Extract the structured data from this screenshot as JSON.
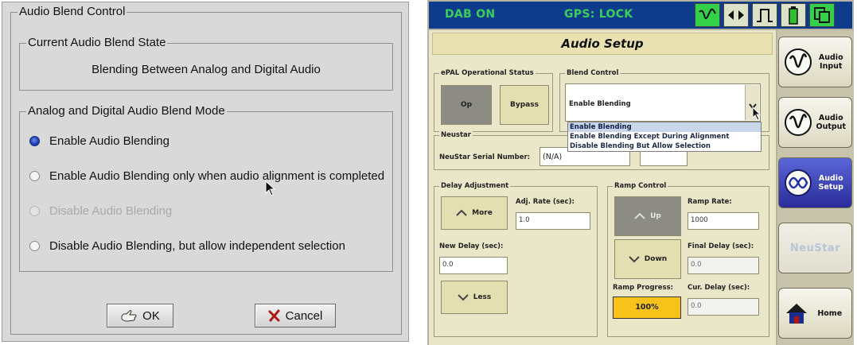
{
  "left_dialog": {
    "title": "Audio Blend Control",
    "state_group_title": "Current Audio Blend State",
    "state_text": "Blending Between Analog and Digital Audio",
    "mode_group_title": "Analog and Digital Audio Blend Mode",
    "options": [
      {
        "label": "Enable Audio Blending",
        "checked": true,
        "disabled": false
      },
      {
        "label": "Enable Audio Blending only when audio alignment is completed",
        "checked": false,
        "disabled": false
      },
      {
        "label": "Disable Audio Blending",
        "checked": false,
        "disabled": true
      },
      {
        "label": "Disable Audio Blending, but allow independent selection",
        "checked": false,
        "disabled": false
      }
    ],
    "ok_label": "OK",
    "cancel_label": "Cancel"
  },
  "right_panel": {
    "status": {
      "dab": "DAB ON",
      "gps": "GPS: LOCK",
      "icons": [
        "waveform-icon",
        "arrows-icon",
        "pulse-icon",
        "battery-icon",
        "copy-icon"
      ],
      "colors": {
        "bar": "#0f3b8c",
        "text": "#37d05a",
        "active_icon_bg": "#35d04a"
      }
    },
    "title": "Audio Setup",
    "epal": {
      "title": "ePAL Operational Status",
      "op_label": "Op",
      "bypass_label": "Bypass"
    },
    "blend": {
      "title": "Blend Control",
      "selected": "Enable Blending",
      "options": [
        "Enable Blending",
        "Enable Blending Except During Alignment",
        "Disable Blending But Allow Selection"
      ]
    },
    "neustar": {
      "title": "Neustar",
      "serial_label": "NeuStar Serial Number:",
      "serial_value": "(N/A)"
    },
    "delay": {
      "title": "Delay Adjustment",
      "more_label": "More",
      "less_label": "Less",
      "adj_rate_label": "Adj. Rate (sec):",
      "adj_rate_value": "1.0",
      "new_delay_label": "New Delay (sec):",
      "new_delay_value": "0.0"
    },
    "ramp": {
      "title": "Ramp Control",
      "up_label": "Up",
      "down_label": "Down",
      "ramp_rate_label": "Ramp Rate:",
      "ramp_rate_value": "1000",
      "final_delay_label": "Final Delay (sec):",
      "final_delay_value": "0.0",
      "progress_label": "Ramp Progress:",
      "progress_value": "100%",
      "progress_fraction": 1.0,
      "cur_delay_label": "Cur. Delay (sec):",
      "cur_delay_value": "0.0"
    },
    "nav": [
      {
        "label": "Audio Input",
        "icon": "wave-icon",
        "state": "normal"
      },
      {
        "label": "Audio Output",
        "icon": "wave-icon",
        "state": "normal"
      },
      {
        "label": "Audio Setup",
        "icon": "wave-knot-icon",
        "state": "active"
      },
      {
        "label": "NeuStar",
        "icon": "neustar-logo",
        "state": "disabled"
      },
      {
        "label": "Home",
        "icon": "home-icon",
        "state": "normal"
      }
    ]
  }
}
